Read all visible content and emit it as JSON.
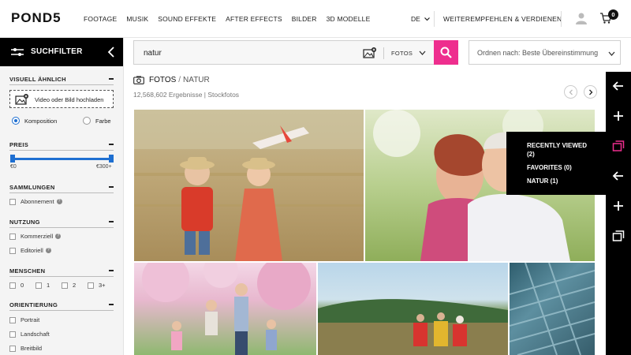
{
  "header": {
    "logo": "POND5",
    "nav": [
      "FOOTAGE",
      "MUSIK",
      "SOUND EFFEKTE",
      "AFTER EFFECTS",
      "BILDER",
      "3D MODELLE"
    ],
    "language": "DE",
    "refer": "WEITEREMPFEHLEN & VERDIENEN",
    "cart_count": "0"
  },
  "sidebar": {
    "title": "SUCHFILTER",
    "visual": {
      "heading": "VISUELL ÄHNLICH",
      "upload_label": "Video oder Bild hochladen",
      "option_composition": "Komposition",
      "option_color": "Farbe"
    },
    "price": {
      "heading": "PREIS",
      "min": "€0",
      "max": "€300+"
    },
    "collections": {
      "heading": "SAMMLUNGEN",
      "subscription": "Abonnement"
    },
    "usage": {
      "heading": "NUTZUNG",
      "commercial": "Kommerziell",
      "editorial": "Editoriell"
    },
    "people": {
      "heading": "MENSCHEN",
      "options": [
        "0",
        "1",
        "2",
        "3+"
      ]
    },
    "orientation": {
      "heading": "ORIENTIERUNG",
      "portrait": "Portrait",
      "landscape": "Landschaft",
      "wide": "Breitbild"
    }
  },
  "search": {
    "query": "natur",
    "type": "FOTOS"
  },
  "sort": {
    "label": "Ordnen nach: Beste Übereinstimmung"
  },
  "results": {
    "type": "FOTOS",
    "term": "NATUR",
    "count": "12,568,602 Ergebnisse | Stockfotos"
  },
  "flyout": {
    "recently_viewed": "RECENTLY VIEWED",
    "recently_viewed_count": "(2)",
    "favorites": "FAVORITES (0)",
    "natur": "NATUR (1)"
  },
  "colors": {
    "accent_pink": "#ee2e8e",
    "slider_blue": "#1e6fd1"
  }
}
